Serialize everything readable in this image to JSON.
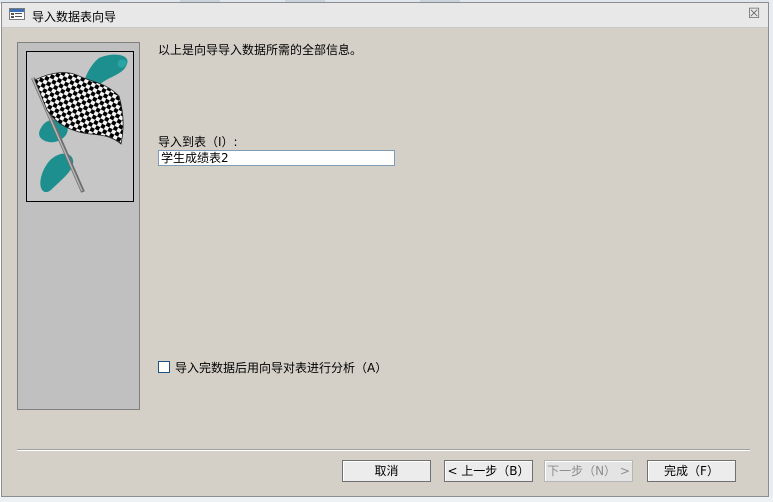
{
  "window": {
    "title": "导入数据表向导",
    "close_label": "☒"
  },
  "wizard": {
    "heading": "以上是向导导入数据所需的全部信息。",
    "import_to_table_label": "导入到表（I）:",
    "table_name_value": "学生成绩表2",
    "analyze_label": "导入完数据后用向导对表进行分析（A）",
    "analyze_checked": false
  },
  "buttons": {
    "cancel": "取消",
    "back": "< 上一步（B）",
    "next": "下一步（N） >",
    "finish": "完成（F）"
  },
  "colors": {
    "dialog_bg": "#d4d0c8",
    "side_panel": "#c0c0c0",
    "flag_teal": "#1d8f8f"
  },
  "icons": {
    "title_icon": "form-window-icon",
    "illustration": "checkered-flag-icon"
  }
}
